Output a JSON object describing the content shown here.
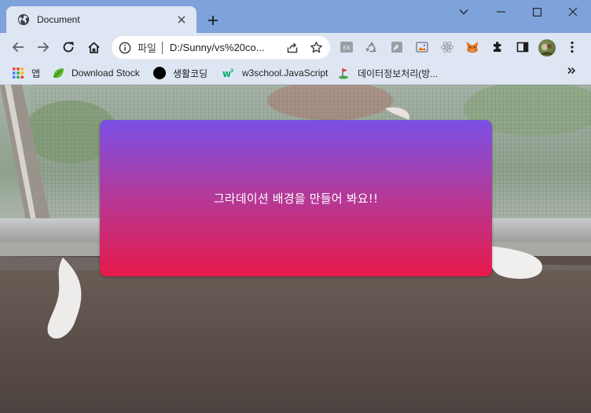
{
  "browser": {
    "tab": {
      "title": "Document"
    },
    "omnibox": {
      "scheme_label": "파일",
      "url": "D:/Sunny/vs%20co..."
    },
    "bookmarks": [
      {
        "label": "앱",
        "icon": "apps-grid-icon"
      },
      {
        "label": "Download Stock",
        "icon": "leaf-icon"
      },
      {
        "label": "생활코딩",
        "icon": "black-circle-icon"
      },
      {
        "label": "w3school.JavaScript",
        "icon": "w3-logo-icon"
      },
      {
        "label": "데이터정보처리(방...",
        "icon": "golf-flag-icon"
      }
    ],
    "extensions": [
      "ex-extension-icon",
      "recycle-icon",
      "pdf-icon",
      "screenshot-icon",
      "react-icon",
      "metamask-fox-icon",
      "puzzle-icon",
      "sidepanel-icon"
    ]
  },
  "page": {
    "card_text": "그라데이션 배경을 만들어 봐요!!"
  },
  "colors": {
    "titlebar": "#7ea3db",
    "toolbar": "#dfe6f3",
    "gradient_top": "#7b4fe6",
    "gradient_bottom": "#e8194a"
  }
}
